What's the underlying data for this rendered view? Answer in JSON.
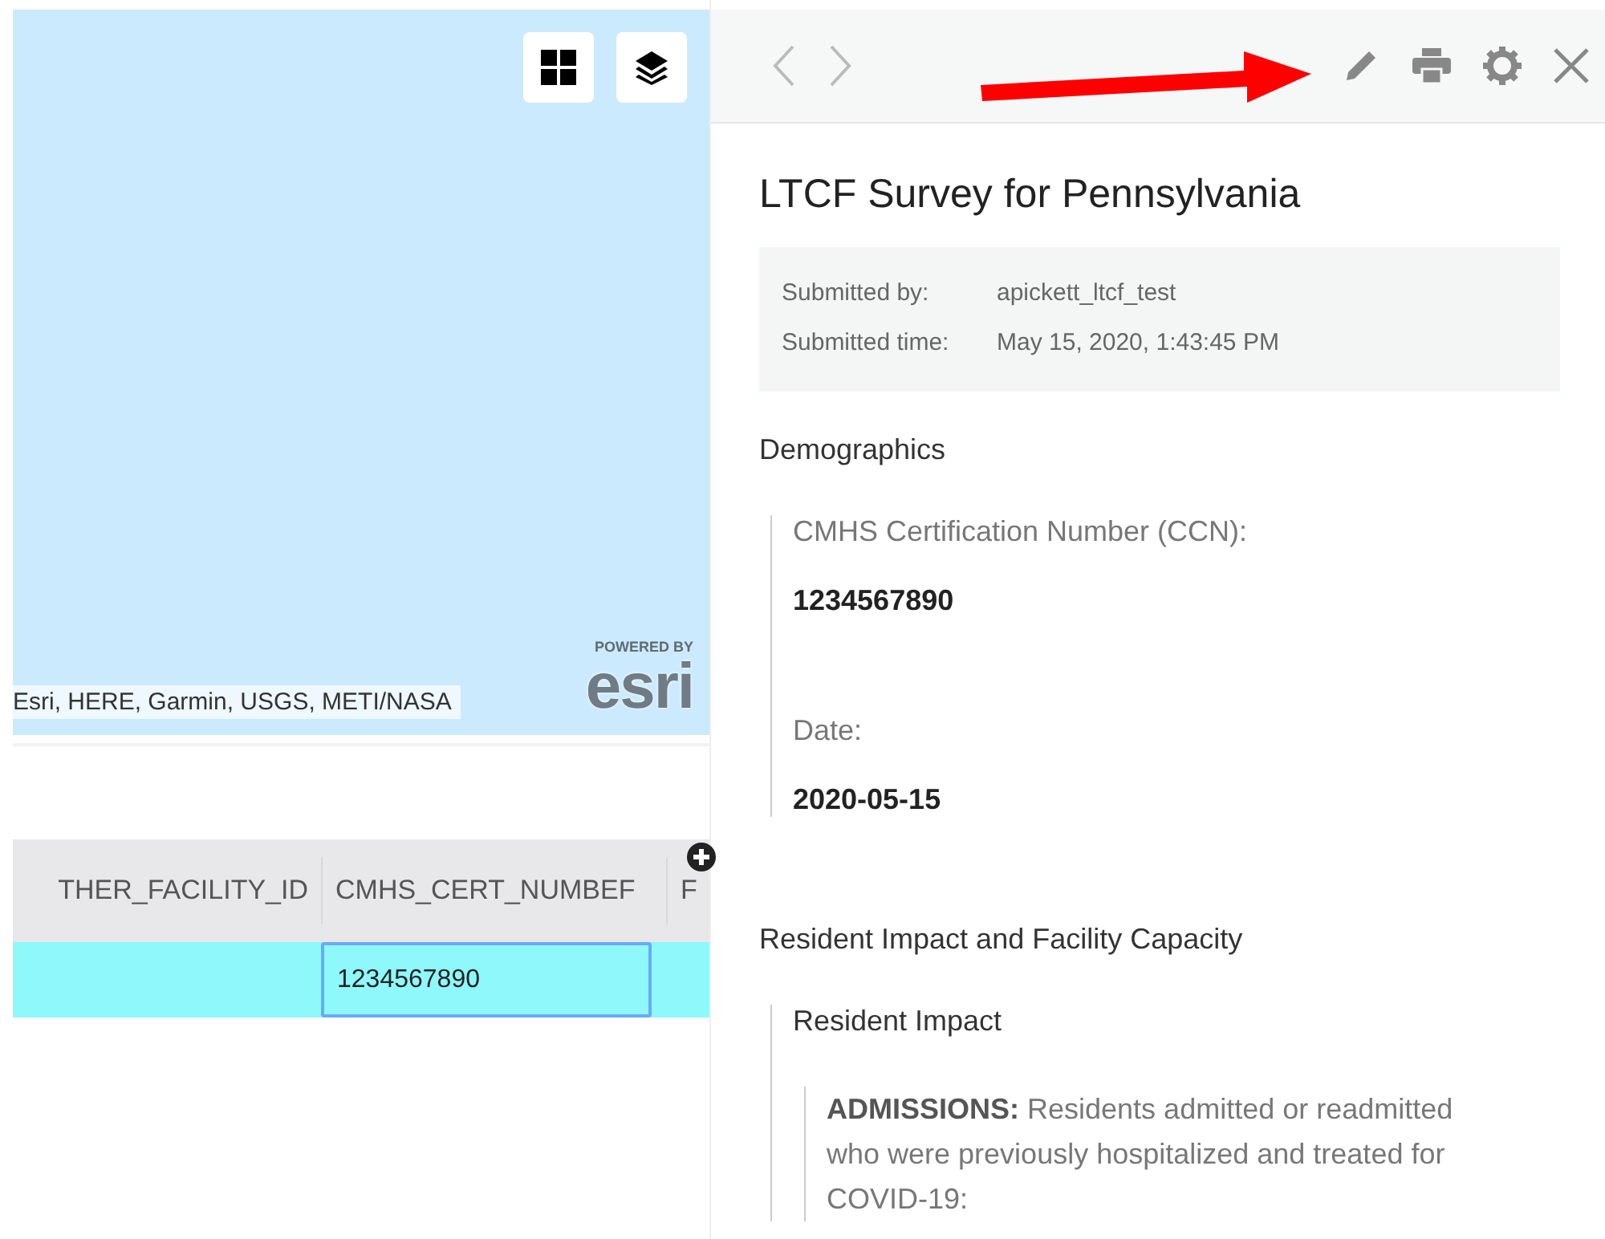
{
  "map": {
    "buttons": [
      {
        "kind": "grid"
      },
      {
        "kind": "layers"
      }
    ],
    "attribution": "Esri, HERE, Garmin, USGS, METI/NASA",
    "logo": {
      "tagline": "POWERED BY",
      "name": "esri"
    }
  },
  "table": {
    "columns": [
      "THER_FACILITY_ID",
      "CMHS_CERT_NUMBEF",
      "F"
    ],
    "rows": [
      {
        "selected": true,
        "cells": [
          {
            "focused": false
          },
          {
            "text": "1234567890",
            "focused": true
          }
        ]
      }
    ]
  },
  "popup": {
    "toolbar": [
      {
        "kind": "previous"
      },
      {
        "kind": "next"
      },
      {
        "kind": "edit"
      },
      {
        "kind": "print"
      },
      {
        "kind": "settings"
      },
      {
        "kind": "close"
      }
    ],
    "title": "LTCF Survey for Pennsylvania",
    "meta": [
      {
        "label": "Submitted by:",
        "value": "apickett_ltcf_test"
      },
      {
        "label": "Submitted time:",
        "value": "May 15, 2020, 1:43:45 PM"
      }
    ],
    "sections": [
      {
        "title": "Demographics",
        "fields": [
          {
            "label": "CMHS Certification Number (CCN):",
            "value": "1234567890"
          },
          {
            "label": "Date:",
            "value": "2020-05-15"
          }
        ]
      },
      {
        "title": "Resident Impact and Facility Capacity",
        "groups": [
          {
            "title": "Resident Impact",
            "paragraphs": [
              "**ADMISSIONS:** Residents admitted or readmitted who were previously hospitalized and treated for COVID-19:"
            ]
          }
        ]
      }
    ]
  }
}
